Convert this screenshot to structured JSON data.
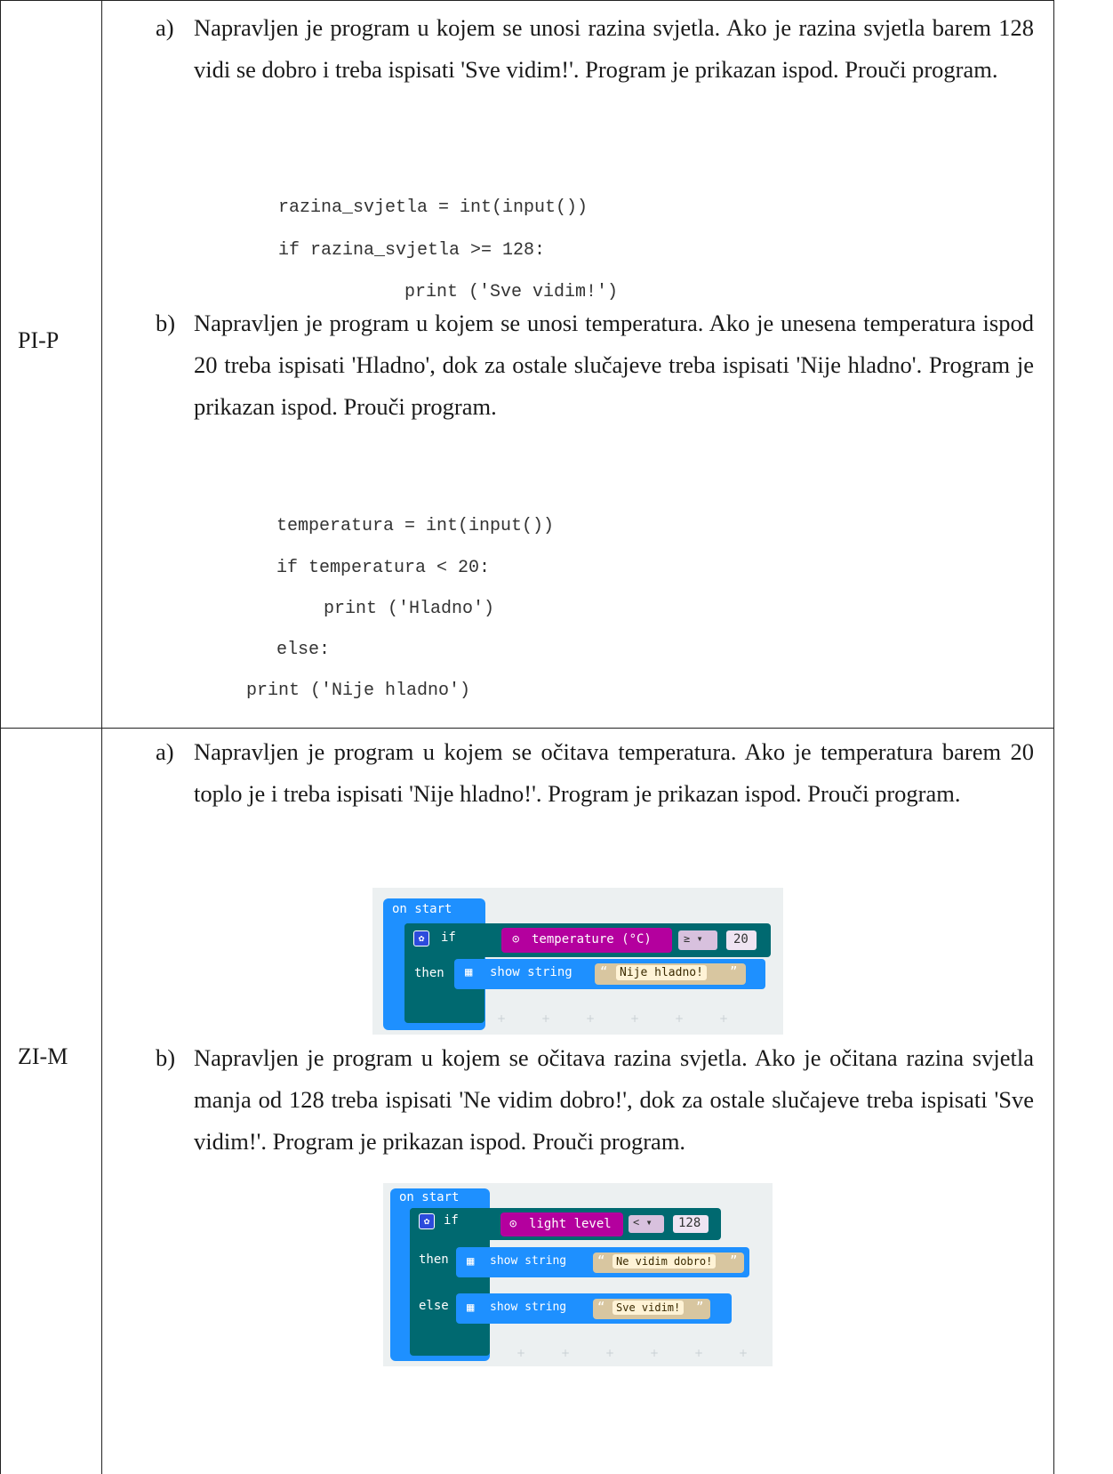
{
  "rows": [
    {
      "label": "PI-P",
      "items": [
        {
          "marker": "a)",
          "text": "Napravljen je program u kojem se unosi razina svjetla. Ako je razina svjetla barem 128 vidi se dobro i treba ispisati 'Sve vidim!'. Program je prikazan ispod. Prouči program.",
          "code": [
            "razina_svjetla = int(input())",
            "if razina_svjetla >= 128:",
            "print ('Sve vidim!')"
          ]
        },
        {
          "marker": "b)",
          "text": "Napravljen je program u kojem se unosi temperatura. Ako je unesena temperatura ispod 20 treba ispisati 'Hladno', dok za ostale slučajeve treba ispisati 'Nije hladno'. Program je prikazan ispod. Prouči program.",
          "code": [
            "temperatura = int(input())",
            "if temperatura < 20:",
            "print ('Hladno')",
            "else:",
            "print ('Nije hladno')"
          ]
        }
      ]
    },
    {
      "label": "ZI-M",
      "items": [
        {
          "marker": "a)",
          "text": "Napravljen je program u kojem se očitava temperatura. Ako je temperatura barem 20 toplo je i treba ispisati 'Nije hladno!'. Program je prikazan ispod. Prouči program.",
          "blocks": {
            "start": "on start",
            "if": "if",
            "then": "then",
            "sensor": "temperature (°C)",
            "op": "≥ ▾",
            "value": "20",
            "show": "show string",
            "string": "Nije hladno!"
          }
        },
        {
          "marker": "b)",
          "text": "Napravljen je program u kojem se očitava razina svjetla. Ako je očitana razina svjetla manja od 128 treba ispisati 'Ne vidim dobro!', dok za ostale slučajeve treba ispisati 'Sve vidim!'. Program je prikazan ispod. Prouči program.",
          "blocks": {
            "start": "on start",
            "if": "if",
            "then": "then",
            "else": "else",
            "sensor": "light level",
            "op": "< ▾",
            "value": "128",
            "show": "show string",
            "string_then": "Ne vidim dobro!",
            "string_else": "Sve vidim!"
          }
        }
      ]
    }
  ]
}
